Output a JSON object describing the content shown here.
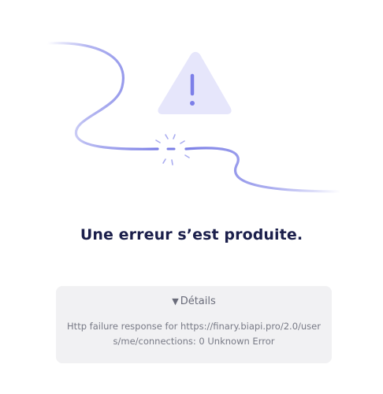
{
  "error": {
    "title": "Une erreur s’est produite.",
    "details_label": "Détails",
    "details_toggle_icon": "triangle-down-icon",
    "message": "Http failure response for https://finary.biapi.pro/2.0/users/me/connections: 0 Unknown Error"
  },
  "illustration": {
    "icon": "warning-triangle-icon",
    "cable": "broken-cable-illustration",
    "colors": {
      "triangle_fill": "#e6e6fb",
      "exclamation": "#7c7fe8",
      "cable": "#7b7fe6",
      "spark": "#a9acf0"
    }
  },
  "colors": {
    "title": "#1b1f4b",
    "card_bg": "#f1f1f3",
    "muted_text": "#787a86"
  }
}
